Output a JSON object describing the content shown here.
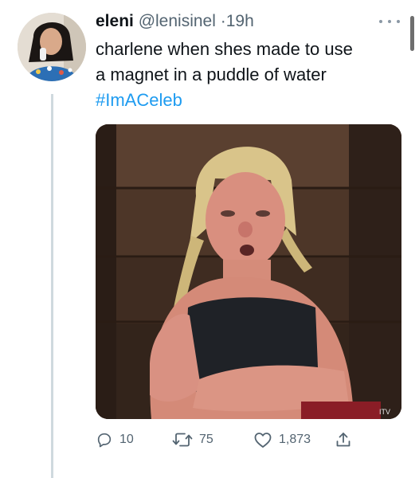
{
  "tweet": {
    "author": {
      "display_name": "eleni",
      "handle": "@lenisinel",
      "separator": "·",
      "time": "19h"
    },
    "text_lines": [
      "charlene when shes made to use",
      "a magnet in a puddle of water"
    ],
    "hashtag": "#ImACeleb",
    "media": {
      "watermark": "ITV"
    },
    "actions": {
      "reply_count": "10",
      "retweet_count": "75",
      "like_count": "1,873"
    }
  },
  "icons": {
    "more": "more-dots-icon",
    "reply": "reply-icon",
    "retweet": "retweet-icon",
    "like": "heart-icon",
    "share": "share-icon"
  },
  "colors": {
    "text": "#0f1419",
    "secondary": "#536471",
    "link": "#1d9bf0",
    "thread_line": "#cfd9de"
  }
}
